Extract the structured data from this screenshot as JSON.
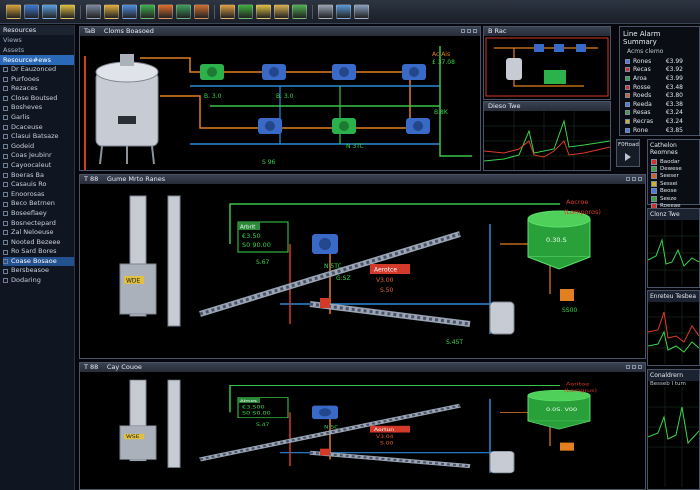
{
  "toolbar": {
    "buttons": [
      {
        "icon": "folder-icon",
        "color": "#d9a43a"
      },
      {
        "icon": "save-icon",
        "color": "#3d7bd4"
      },
      {
        "icon": "edit-icon",
        "color": "#5aa0e0"
      },
      {
        "icon": "alarm-icon",
        "color": "#e0c040"
      },
      {
        "icon": "print-icon",
        "color": "#7c8aa0"
      },
      {
        "icon": "key-icon",
        "color": "#e0b040"
      },
      {
        "icon": "grid-icon",
        "color": "#4e8fe0"
      },
      {
        "icon": "pencil-icon",
        "color": "#3fb050"
      },
      {
        "icon": "tools-icon",
        "color": "#e07030"
      },
      {
        "icon": "arrows-icon",
        "color": "#3fa060"
      },
      {
        "icon": "wrench-icon",
        "color": "#d07030"
      },
      {
        "icon": "box-icon",
        "color": "#e0a040"
      },
      {
        "icon": "chart-icon",
        "color": "#40b040"
      },
      {
        "icon": "lock-icon",
        "color": "#e0c040"
      },
      {
        "icon": "document-icon",
        "color": "#d9b050"
      },
      {
        "icon": "target-icon",
        "color": "#50b050"
      },
      {
        "icon": "gear-icon",
        "color": "#9aa4b4"
      },
      {
        "icon": "globe-icon",
        "color": "#5a9ad8"
      },
      {
        "icon": "user-icon",
        "color": "#8aa0c0"
      }
    ]
  },
  "sidebar": {
    "title": "Resources",
    "items_top": [
      "Views",
      "Assets"
    ],
    "selected": "Resource#ews",
    "tree": [
      "Dr Eauzonced",
      "Purfooes",
      "Rezaces",
      "Close Boutsed",
      "Bosheves",
      "Garlis",
      "Dcaceuse",
      "Clasui Batsaze",
      "Godeid",
      "Coas Jeubinr",
      "Cayoocaleut",
      "Boeras Ba",
      "Casauis Ro",
      "Enoorosas",
      "Beco Betrnen",
      "Boseeflaey",
      "Bosnectepard",
      "Zal Neloeuse",
      "Nooted Bezeee",
      "Ro Sard Bores",
      "Coase Bosaoe",
      "Bersbeasoe",
      "Dodaring"
    ],
    "highlighted_index": 20
  },
  "panels": {
    "top_left": {
      "title": "TaB 　Cloms Boasoed"
    },
    "top_mid": {
      "title": "B Rac"
    },
    "trend1": {
      "title": "Dieso Twe"
    },
    "alarm": {
      "title": "Line Alarm Summary",
      "subtitle": "Acms clemo"
    },
    "main": {
      "title": "T 88 　Gume Mrto Ranes"
    },
    "bottom": {
      "title": "T 88 　Cay Couoe"
    },
    "cathelon": {
      "title": "Cathelon Reomnes"
    },
    "right_trend1": {
      "title": "Clonz Twe"
    },
    "right_trend2": {
      "title": "Enreteu Tesbea"
    },
    "right_trend3": {
      "title": "Conaldrern",
      "subtitle": "Besseb I tum"
    }
  },
  "alarm_rows": [
    {
      "name": "Rones",
      "value": "€3.99",
      "color": "#4a7ae0"
    },
    {
      "name": "Recas",
      "value": "€3.92",
      "color": "#d03030"
    },
    {
      "name": "Aroa",
      "value": "€3.99",
      "color": "#3aa040"
    },
    {
      "name": "Rosse",
      "value": "€3.48",
      "color": "#d03030"
    },
    {
      "name": "Roeds",
      "value": "€3.80",
      "color": "#d06030"
    },
    {
      "name": "Reeda",
      "value": "€3.38",
      "color": "#4a7ae0"
    },
    {
      "name": "Resas",
      "value": "€3.24",
      "color": "#3aa040"
    },
    {
      "name": "Recras",
      "value": "€3.24",
      "color": "#d0b030"
    },
    {
      "name": "Rone",
      "value": "€3.85",
      "color": "#4a7ae0"
    }
  ],
  "refresh_label": "F0ftoad",
  "cathelon_rows": [
    {
      "name": "Baodar",
      "color": "#d03030"
    },
    {
      "name": "Dewese",
      "color": "#3aa040"
    },
    {
      "name": "Seeser",
      "color": "#d06030"
    },
    {
      "name": "Sessei",
      "color": "#d0b030"
    },
    {
      "name": "Beose",
      "color": "#4a7ae0"
    },
    {
      "name": "Seeze",
      "color": "#3aa040"
    },
    {
      "name": "Roeeae",
      "color": "#d03030"
    }
  ],
  "top_labels": {
    "equip1": "Ac Ais",
    "v1": "£ 37.08",
    "equip2": "B. 3.0",
    "equip3": "B. 3.0",
    "equip4": "N 3TC",
    "v2": "B.8K",
    "v3": "S 96"
  },
  "main_labels": {
    "tag1": "Arbrit",
    "val1": "€3.50",
    "val2": "S0 90.00",
    "val3": "S.67",
    "pump_tag": "N 5TC",
    "alarm_tag": "Aerotce",
    "alarm_val1": "V3.00",
    "alarm_val2": "S.50",
    "tank_val": "0.30.S",
    "note1": "Aocroe",
    "note2": "(Lomporos)",
    "v_g": "G:SZ",
    "v_b": "S.45T",
    "v_c": "SS00",
    "tower_tag": "WDE"
  },
  "bottom_labels": {
    "tag1": "Almos",
    "val1": "€3.S00",
    "val2": "S0 S0.00",
    "val3": "S.47",
    "pump_tag": "N 5C",
    "alarm_tag": "Aortun",
    "alarm_val1": "V3.04",
    "alarm_val2": "S.00",
    "tank_val": "0.0S. V00",
    "note1": "Aoritoe",
    "note2": "(Lomgrus)",
    "tower_tag": "WSE"
  },
  "trend_colors": {
    "green": "#37d44a",
    "red": "#e03a2a",
    "grid": "#1e3a2a"
  }
}
